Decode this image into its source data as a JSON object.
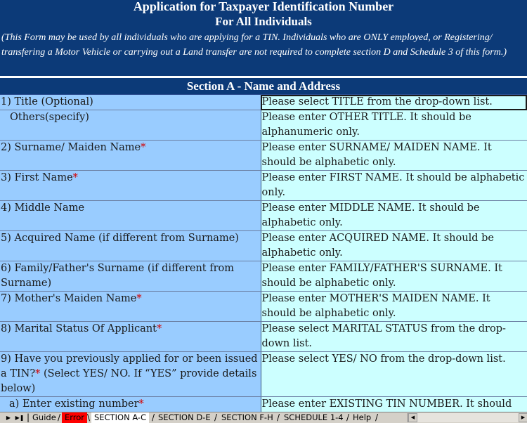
{
  "header": {
    "title": "Application for Taxpayer Identification Number",
    "subtitle": "For All Individuals",
    "intro": "(This Form may be used by all individuals who are applying for a TIN.  Individuals who are ONLY employed, or Registering/ transfering a Motor Vehicle or carrying out a Land transfer are not required to complete section D and Schedule 3 of this form.)",
    "section": "Section A - Name and Address"
  },
  "rows": [
    {
      "label": "1) Title (Optional)",
      "req": "",
      "hint": "Please select TITLE from the drop-down list.",
      "h": 21
    },
    {
      "label": "Others(specify)",
      "req": "",
      "hint": "Please enter OTHER TITLE. It should be alphanumeric only.",
      "h": 42
    },
    {
      "label": "2) Surname/ Maiden Name",
      "req": "*",
      "hint": "Please enter SURNAME/ MAIDEN NAME. It should be alphabetic only.",
      "h": 42
    },
    {
      "label": "3) First Name",
      "req": "*",
      "hint": "Please enter FIRST NAME. It should be alphabetic only.",
      "h": 42
    },
    {
      "label": "4) Middle Name",
      "req": "",
      "hint": "Please enter MIDDLE NAME. It should be alphabetic only.",
      "h": 42
    },
    {
      "label": "5) Acquired Name (if different from Surname)",
      "req": "",
      "hint": "Please enter ACQUIRED NAME. It should be alphabetic only.",
      "h": 42
    },
    {
      "label": "6) Family/Father's Surname (if different from Surname)",
      "req": "",
      "hint": "Please enter FAMILY/FATHER'S SURNAME. It should be alphabetic only.",
      "h": 42
    },
    {
      "label": "7) Mother's Maiden Name",
      "req": "*",
      "hint": "Please enter MOTHER'S MAIDEN NAME. It should be alphabetic only.",
      "h": 42
    },
    {
      "label": "8) Marital Status Of Applicant",
      "req": "*",
      "hint": "Please select MARITAL STATUS from the drop-down list.",
      "h": 42
    },
    {
      "label": "9) Have you previously applied for or been issued a TIN?",
      "req": "*",
      "label_suffix": " (Select YES/ NO. If “YES” provide details below)",
      "hint": "Please select YES/ NO from the drop-down list.",
      "h": 63
    },
    {
      "label": "a) Enter existing number",
      "req": "*",
      "hint": "Please enter EXISTING TIN NUMBER. It should be",
      "h": 30
    }
  ],
  "tabs": {
    "guide": "Guide",
    "error": "Error",
    "section_ac": "SECTION A-C",
    "section_de": "SECTION D-E",
    "section_fh": "SECTION F-H",
    "schedule": "SCHEDULE 1-4",
    "help": "Help"
  },
  "icons": {
    "nav_next": "play-right-icon",
    "nav_last": "skip-last-icon",
    "scroll_left": "arrow-left-icon",
    "scroll_right": "arrow-right-icon"
  },
  "colors": {
    "header_bg": "#0c3a78",
    "label_bg": "#99ccff",
    "hint_bg": "#ccffff",
    "required": "#d40000",
    "error_tab": "#ff0000"
  }
}
